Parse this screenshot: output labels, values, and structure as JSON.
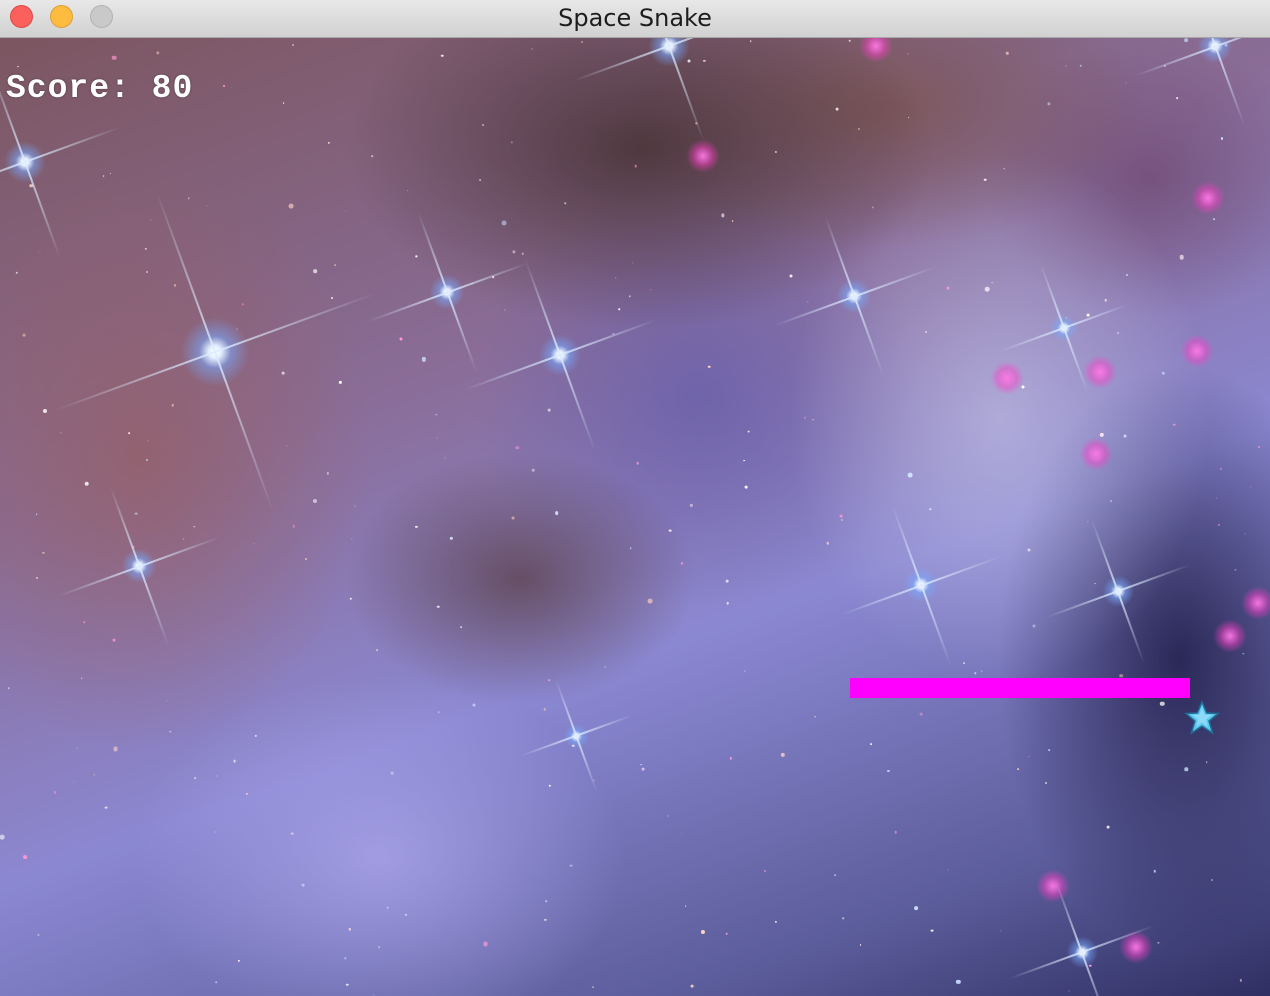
{
  "window": {
    "title": "Space Snake",
    "buttons": {
      "close": "close-button",
      "minimize": "minimize-button",
      "zoom": "zoom-button"
    }
  },
  "hud": {
    "score_label": "Score:",
    "score_value": "80"
  },
  "colors": {
    "snake": "#ff00ff",
    "food": "#5fc8f0",
    "score_text": "#ffffff"
  },
  "entities": {
    "snake": {
      "icon": "snake-body",
      "direction": "horizontal"
    },
    "food": {
      "icon": "star-icon"
    }
  },
  "background": {
    "icon": "nebula-space-background"
  }
}
